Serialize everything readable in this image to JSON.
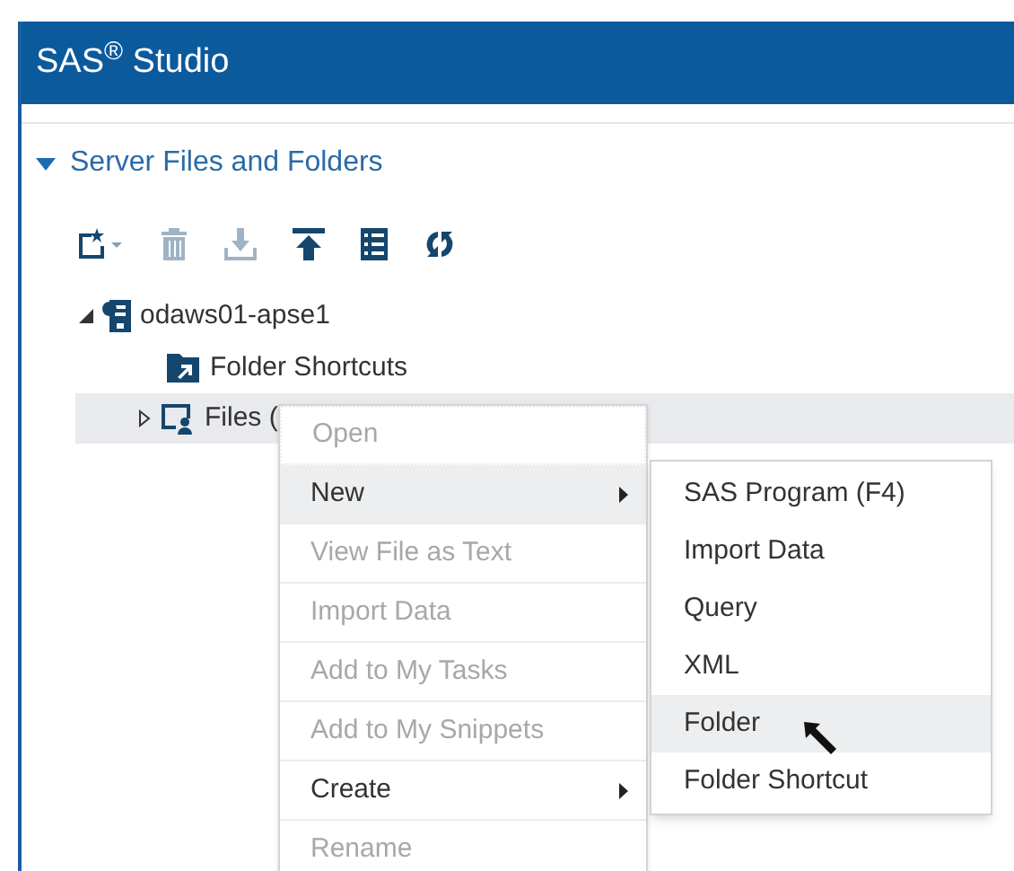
{
  "window": {
    "title": "SAS$^{®}$ Studio"
  },
  "section": {
    "title": "Server Files and Folders",
    "expanded": true
  },
  "toolbar": [
    {
      "kind": "new",
      "disabled": false
    },
    {
      "kind": "delete",
      "disabled": true
    },
    {
      "kind": "download",
      "disabled": true
    },
    {
      "kind": "upload",
      "disabled": false
    },
    {
      "kind": "properties",
      "disabled": false
    },
    {
      "kind": "refresh",
      "disabled": false
    }
  ],
  "tree": [
    {
      "label": "odaws01-apse1",
      "kind": "server",
      "expanded": true,
      "children": [
        {
          "label": "Folder Shortcuts",
          "kind": "shortcuts",
          "selected": false
        },
        {
          "label": "Files (",
          "kind": "files",
          "selected": true,
          "expanded": false
        }
      ]
    }
  ],
  "context_menu": [
    {
      "label": "Open",
      "disabled": true,
      "selected": false,
      "submenu": false
    },
    {
      "label": "New",
      "disabled": false,
      "selected": true,
      "submenu": true
    },
    {
      "label": "View File as Text",
      "disabled": true,
      "selected": false,
      "submenu": false
    },
    {
      "label": "Import Data",
      "disabled": true,
      "selected": false,
      "submenu": false
    },
    {
      "label": "Add to My Tasks",
      "disabled": true,
      "selected": false,
      "submenu": false
    },
    {
      "label": "Add to My Snippets",
      "disabled": true,
      "selected": false,
      "submenu": false
    },
    {
      "label": "Create",
      "disabled": false,
      "selected": false,
      "submenu": true
    },
    {
      "label": "Rename",
      "disabled": true,
      "selected": false,
      "submenu": false
    }
  ],
  "submenu": [
    {
      "label": "SAS Program (F4)",
      "selected": false
    },
    {
      "label": "Import Data",
      "selected": false
    },
    {
      "label": "Query",
      "selected": false
    },
    {
      "label": "XML",
      "selected": false
    },
    {
      "label": "Folder",
      "selected": true
    },
    {
      "label": "Folder Shortcut",
      "selected": false
    }
  ]
}
